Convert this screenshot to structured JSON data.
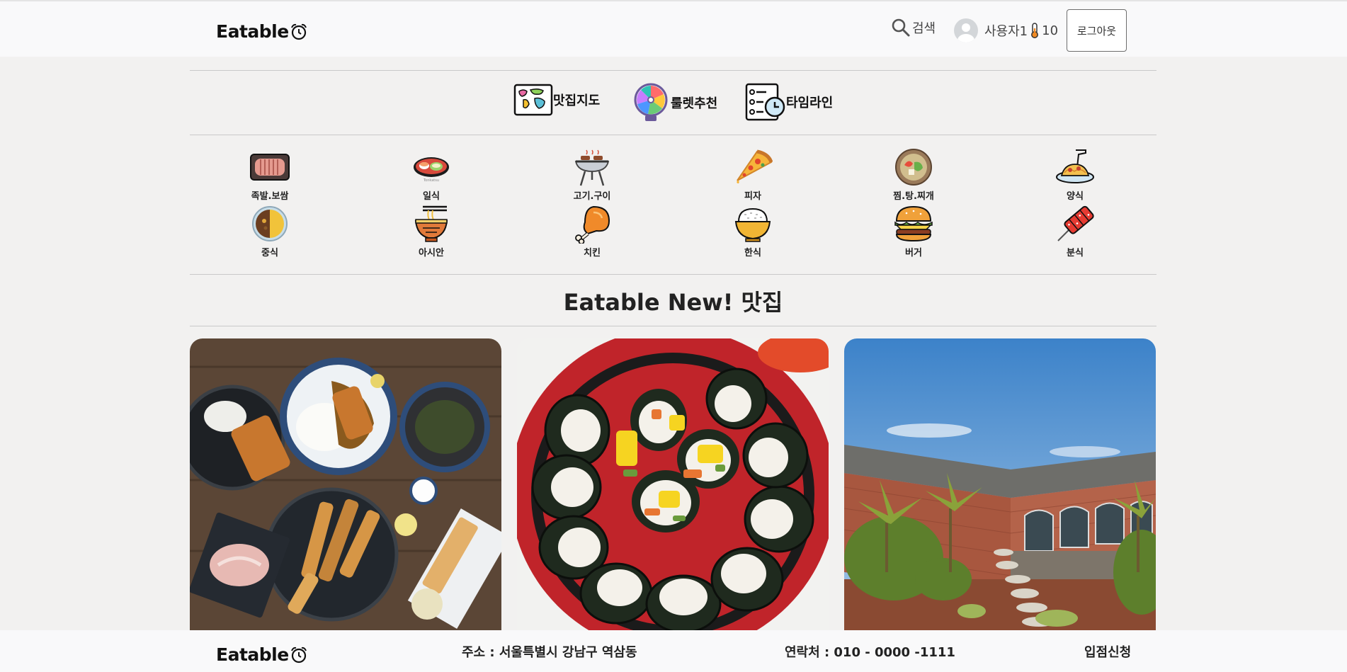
{
  "header": {
    "logo": "Eatable",
    "search_label": "검색",
    "user_name": "사용자1",
    "user_temp": "10",
    "logout_label": "로그아웃"
  },
  "quick_menu": [
    {
      "label": "맛집지도",
      "icon": "map-icon"
    },
    {
      "label": "룰렛추천",
      "icon": "roulette-icon"
    },
    {
      "label": "타임라인",
      "icon": "timeline-icon"
    }
  ],
  "categories": [
    {
      "label": "족발.보쌈",
      "icon": "pork-icon"
    },
    {
      "label": "일식",
      "icon": "sushi-icon"
    },
    {
      "label": "고기.구이",
      "icon": "grill-icon"
    },
    {
      "label": "피자",
      "icon": "pizza-icon"
    },
    {
      "label": "찜.탕.찌개",
      "icon": "stew-icon"
    },
    {
      "label": "양식",
      "icon": "pasta-icon"
    },
    {
      "label": "중식",
      "icon": "curry-icon"
    },
    {
      "label": "아시안",
      "icon": "noodle-icon"
    },
    {
      "label": "치킨",
      "icon": "chicken-icon"
    },
    {
      "label": "한식",
      "icon": "rice-icon"
    },
    {
      "label": "버거",
      "icon": "burger-icon"
    },
    {
      "label": "분식",
      "icon": "tteokbokki-icon"
    }
  ],
  "section_title": "Eatable New! 맛집",
  "footer": {
    "logo": "Eatable",
    "address": "주소 : 서울특별시 강남구 역삼동",
    "contact": "연락처 : 010 - 0000 -1111",
    "apply": "입점신청"
  },
  "colors": {
    "background": "#f2f1f0",
    "header_bg": "#f9f9fa",
    "divider": "#c9c9c9",
    "text": "#222222"
  }
}
